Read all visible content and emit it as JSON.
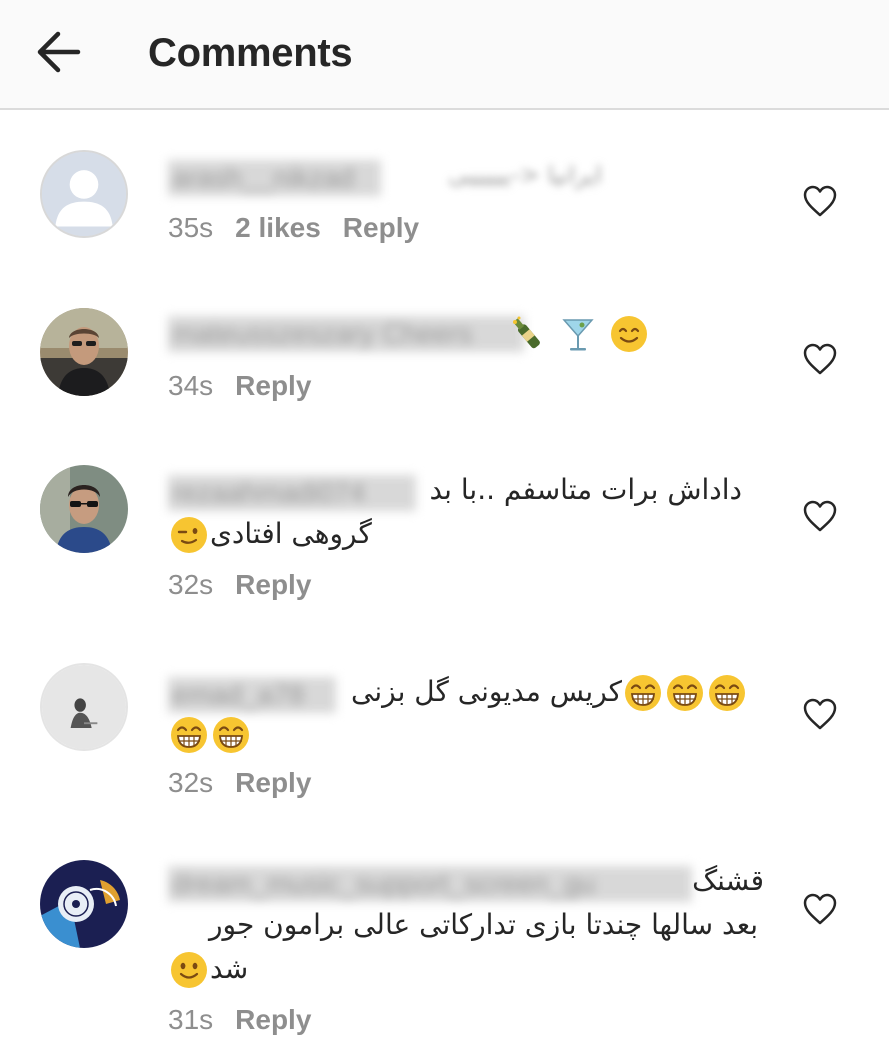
{
  "header": {
    "title": "Comments",
    "back_icon": "arrow-left-icon"
  },
  "colors": {
    "meta_text": "#8e8e8e",
    "header_bg": "#fafafa",
    "heart_outline": "#262626",
    "emoji_yellow": "#f7c531"
  },
  "comments": [
    {
      "username": "arash__nikzad",
      "text": "ایرانیا <-ییییییی",
      "text_blurred": true,
      "emojis": [],
      "time": "35s",
      "likes": "2 likes",
      "reply": "Reply",
      "avatar": "default-avatar-icon"
    },
    {
      "username": "mateusszeszary Cheers",
      "text": "",
      "text_blurred": false,
      "emojis": [
        "champagne-emoji",
        "cocktail-emoji",
        "smiling-emoji"
      ],
      "time": "34s",
      "likes": "",
      "reply": "Reply",
      "avatar": "man-sunglasses-avatar"
    },
    {
      "username": "rezaahmadi074",
      "text_line1": "داداش برات متاسفم ..با بد",
      "text_line2": "گروهی افتادی",
      "emojis": [
        "winking-emoji"
      ],
      "time": "32s",
      "likes": "",
      "reply": "Reply",
      "avatar": "young-man-avatar"
    },
    {
      "username": "emad_a78",
      "text_line1": "کریس مدیونی گل بزنی",
      "emojis_line1": [
        "laughing-emoji",
        "laughing-emoji",
        "laughing-emoji"
      ],
      "emojis_line2": [
        "laughing-emoji",
        "laughing-emoji"
      ],
      "time": "32s",
      "likes": "",
      "reply": "Reply",
      "avatar": "grey-photo-avatar"
    },
    {
      "username": "dream_music_support_screen_gu",
      "text_line1": "قشنگ",
      "text_line2": "بعد سالها چندتا بازی تدارکاتی عالی برامون جور",
      "text_line3": "شد",
      "emojis": [
        "smiling-emoji"
      ],
      "time": "31s",
      "likes": "",
      "reply": "Reply",
      "avatar": "vinyl-record-avatar"
    }
  ]
}
